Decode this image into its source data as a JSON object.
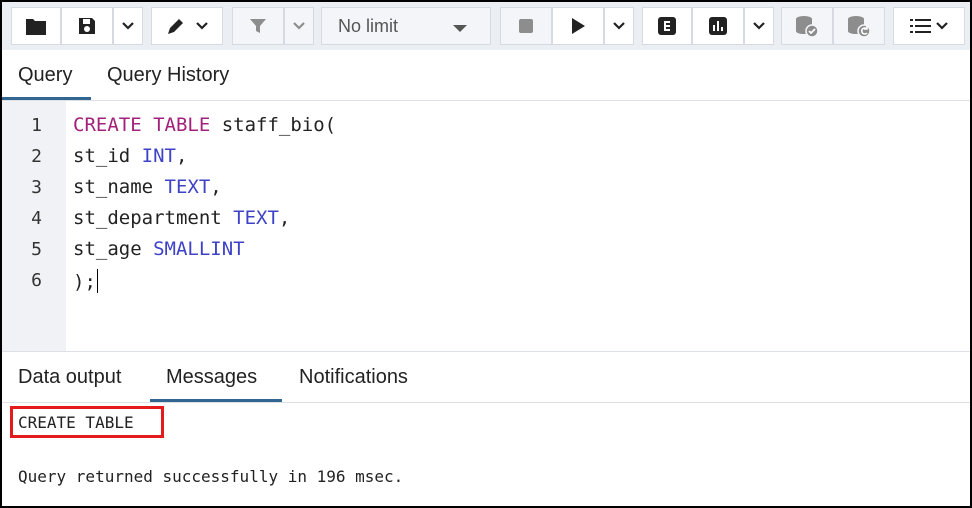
{
  "toolbar": {
    "limit_select_value": "No limit"
  },
  "query_tabs": [
    {
      "label": "Query",
      "active": true
    },
    {
      "label": "Query History",
      "active": false
    }
  ],
  "editor": {
    "line_numbers": [
      "1",
      "2",
      "3",
      "4",
      "5",
      "6"
    ],
    "lines": [
      [
        {
          "t": "CREATE TABLE",
          "c": "keyword"
        },
        {
          "t": " staff_bio(",
          "c": "plain"
        }
      ],
      [
        {
          "t": "st_id ",
          "c": "plain"
        },
        {
          "t": "INT",
          "c": "type"
        },
        {
          "t": ",",
          "c": "plain"
        }
      ],
      [
        {
          "t": "st_name ",
          "c": "plain"
        },
        {
          "t": "TEXT",
          "c": "type"
        },
        {
          "t": ",",
          "c": "plain"
        }
      ],
      [
        {
          "t": "st_department ",
          "c": "plain"
        },
        {
          "t": "TEXT",
          "c": "type"
        },
        {
          "t": ",",
          "c": "plain"
        }
      ],
      [
        {
          "t": "st_age ",
          "c": "plain"
        },
        {
          "t": "SMALLINT",
          "c": "type"
        }
      ],
      [
        {
          "t": ");",
          "c": "plain"
        }
      ]
    ]
  },
  "output_tabs": [
    {
      "label": "Data output",
      "active": false
    },
    {
      "label": "Messages",
      "active": true
    },
    {
      "label": "Notifications",
      "active": false
    }
  ],
  "messages": {
    "result": "CREATE TABLE",
    "status": "Query returned successfully in 196 msec."
  },
  "colors": {
    "keyword": "#a3217b",
    "type": "#3d42c7",
    "accent": "#326690",
    "highlight_box": "#e31b1b"
  }
}
